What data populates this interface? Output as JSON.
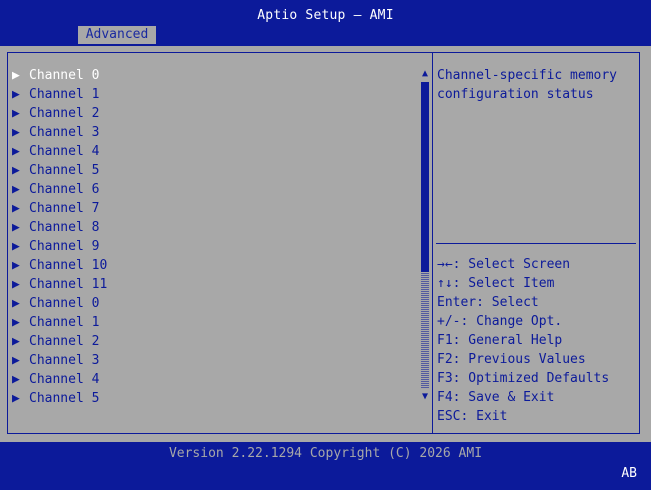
{
  "title": "Aptio Setup – AMI",
  "tab": "Advanced",
  "channels": [
    "Channel 0",
    "Channel 1",
    "Channel 2",
    "Channel 3",
    "Channel 4",
    "Channel 5",
    "Channel 6",
    "Channel 7",
    "Channel 8",
    "Channel 9",
    "Channel 10",
    "Channel 11",
    "Channel 0",
    "Channel 1",
    "Channel 2",
    "Channel 3",
    "Channel 4",
    "Channel 5"
  ],
  "selected_index": 0,
  "scroll": {
    "up_icon": "scroll-up-triangle",
    "down_icon": "scroll-down-triangle"
  },
  "help": {
    "line1": "Channel-specific memory",
    "line2": "configuration status"
  },
  "keys": [
    "→←: Select Screen",
    "↑↓: Select Item",
    "Enter: Select",
    "+/-: Change Opt.",
    "F1: General Help",
    "F2: Previous Values",
    "F3: Optimized Defaults",
    "F4: Save & Exit",
    "ESC: Exit"
  ],
  "footer": {
    "version": "Version 2.22.1294 Copyright (C) 2026 AMI",
    "badge": "AB"
  },
  "colors": {
    "bios_blue": "#0c1a9a",
    "panel_gray": "#a8a8a8",
    "highlight": "#ffffff"
  }
}
